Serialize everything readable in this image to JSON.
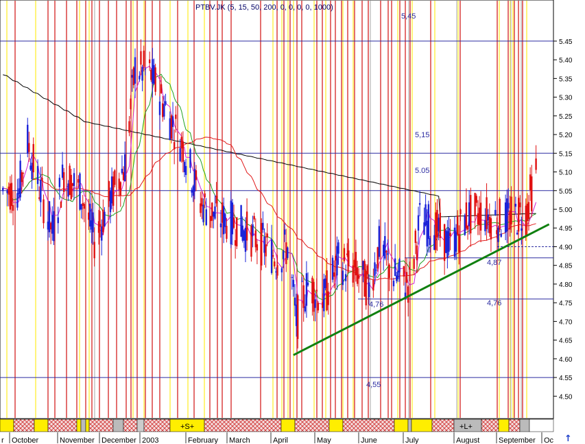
{
  "chart_data": {
    "type": "candlestick",
    "title": "PTBV.JK (5, 15, 50, 200, 0, 0, 0, 0, 1000)",
    "ylim": [
      4.44,
      5.56
    ],
    "y_ticks": [
      "4.50",
      "4.55",
      "4.60",
      "4.65",
      "4.70",
      "4.75",
      "4.80",
      "4.85",
      "4.90",
      "4.95",
      "5.00",
      "5.05",
      "5.10",
      "5.15",
      "5.20",
      "5.25",
      "5.30",
      "5.35",
      "5.40",
      "5.45"
    ],
    "x_labels": [
      "r",
      "October",
      "November",
      "December",
      "2003",
      "February",
      "March",
      "April",
      "May",
      "June",
      "July",
      "August",
      "September",
      "Oc"
    ],
    "horizontal_levels": [
      {
        "value": 5.45,
        "label": "5,45"
      },
      {
        "value": 5.15,
        "label": "5,15"
      },
      {
        "value": 5.05,
        "label": "5.05"
      },
      {
        "value": 4.87,
        "label": "4,87"
      },
      {
        "value": 4.76,
        "label": "4,76"
      },
      {
        "value": 4.76,
        "label": "4,76"
      },
      {
        "value": 4.55,
        "label": "4,55"
      }
    ],
    "trendline": {
      "from": {
        "date": "2003-04-08",
        "value": 4.61
      },
      "to": {
        "date": "2003-10-01",
        "value": 4.96
      }
    },
    "support_dashed": {
      "value": 4.9
    },
    "band_labels": [
      "+S+",
      "+L+"
    ],
    "series_colors": {
      "up": "#1a22d8",
      "down": "#e01010",
      "ma5": "#d020d0",
      "ma15": "#20a020",
      "ma50": "#e01818",
      "ma200": "#000000"
    },
    "price_series": [
      {
        "date": "2002-09-20",
        "close": 5.05
      },
      {
        "date": "2002-10-01",
        "close": 5.05
      },
      {
        "date": "2002-10-07",
        "close": 5.18
      },
      {
        "date": "2002-10-15",
        "close": 5.06
      },
      {
        "date": "2002-10-24",
        "close": 4.94
      },
      {
        "date": "2002-11-01",
        "close": 5.1
      },
      {
        "date": "2002-11-12",
        "close": 5.05
      },
      {
        "date": "2002-11-22",
        "close": 4.92
      },
      {
        "date": "2002-12-03",
        "close": 5.03
      },
      {
        "date": "2002-12-13",
        "close": 5.12
      },
      {
        "date": "2002-12-20",
        "close": 5.38
      },
      {
        "date": "2002-12-31",
        "close": 5.36
      },
      {
        "date": "2003-01-10",
        "close": 5.27
      },
      {
        "date": "2003-01-22",
        "close": 5.17
      },
      {
        "date": "2003-02-03",
        "close": 5.02
      },
      {
        "date": "2003-02-14",
        "close": 4.98
      },
      {
        "date": "2003-02-28",
        "close": 4.96
      },
      {
        "date": "2003-03-14",
        "close": 4.92
      },
      {
        "date": "2003-03-28",
        "close": 4.87
      },
      {
        "date": "2003-04-04",
        "close": 4.9
      },
      {
        "date": "2003-04-10",
        "close": 4.7
      },
      {
        "date": "2003-04-18",
        "close": 4.8
      },
      {
        "date": "2003-04-29",
        "close": 4.76
      },
      {
        "date": "2003-05-09",
        "close": 4.86
      },
      {
        "date": "2003-05-20",
        "close": 4.84
      },
      {
        "date": "2003-05-30",
        "close": 4.79
      },
      {
        "date": "2003-06-06",
        "close": 4.9
      },
      {
        "date": "2003-06-17",
        "close": 4.82
      },
      {
        "date": "2003-06-27",
        "close": 4.8
      },
      {
        "date": "2003-07-04",
        "close": 4.97
      },
      {
        "date": "2003-07-14",
        "close": 4.95
      },
      {
        "date": "2003-07-25",
        "close": 4.9
      },
      {
        "date": "2003-08-05",
        "close": 4.98
      },
      {
        "date": "2003-08-15",
        "close": 4.99
      },
      {
        "date": "2003-08-27",
        "close": 4.97
      },
      {
        "date": "2003-09-05",
        "close": 4.98
      },
      {
        "date": "2003-09-15",
        "close": 4.99
      },
      {
        "date": "2003-09-22",
        "close": 5.1
      }
    ]
  }
}
